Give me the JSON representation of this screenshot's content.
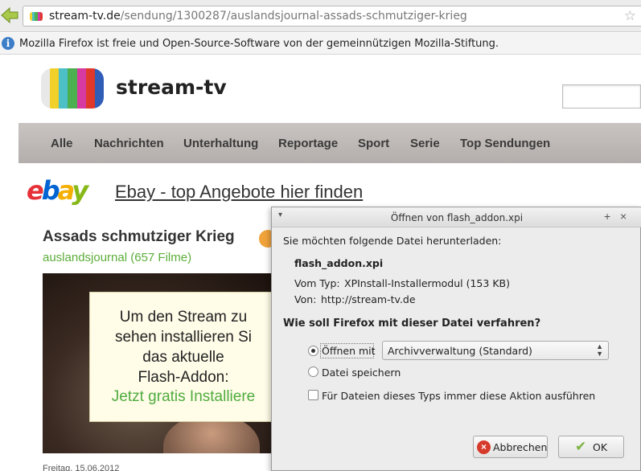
{
  "browser": {
    "url_host": "stream-tv.de",
    "url_path": "/sendung/1300287/auslandsjournal-assads-schmutziger-krieg",
    "info_message": "Mozilla Firefox ist freie und Open-Source-Software von der gemeinnützigen Mozilla-Stiftung."
  },
  "site": {
    "title": "stream-tv",
    "logo_colors": [
      "#e8e8e8",
      "#f2d02a",
      "#4cc0c6",
      "#4caf50",
      "#d63aa0",
      "#e0392b",
      "#2f5db8"
    ],
    "nav": [
      "Alle",
      "Nachrichten",
      "Unterhaltung",
      "Reportage",
      "Sport",
      "Serie",
      "Top Sendungen"
    ]
  },
  "ad": {
    "logo_letters": [
      "e",
      "b",
      "a",
      "y"
    ],
    "logo_colors": [
      "#e53238",
      "#0064d2",
      "#f5af02",
      "#86b817"
    ],
    "link_text": "Ebay - top Angebote hier finden"
  },
  "article": {
    "title": "Assads schmutziger Krieg",
    "channel": "auslandsjournal (657 Filme)",
    "overlay_lines": [
      "Um den Stream zu",
      "sehen installieren Si",
      "das aktuelle",
      "Flash-Addon:"
    ],
    "overlay_link": "Jetzt gratis Installiere",
    "date": "Freitag, 15.06.2012"
  },
  "dialog": {
    "menu_glyph": "▾",
    "title": "Öffnen von flash_addon.xpi",
    "pin_glyph": "+",
    "close_glyph": "×",
    "prompt": "Sie möchten folgende Datei herunterladen:",
    "filename": "flash_addon.xpi",
    "type_label": "Vom Typ:",
    "type_value": "XPInstall-Installermodul (153 KB)",
    "from_label": "Von:",
    "from_value": "http://stream-tv.de",
    "question": "Wie soll Firefox mit dieser Datei verfahren?",
    "open_with_label": "Öffnen mit",
    "open_with_app": "Archivverwaltung (Standard)",
    "save_label": "Datei speichern",
    "always_label": "Für Dateien dieses Typs immer diese Aktion ausführen",
    "cancel_label": "Abbrechen",
    "ok_label": "OK"
  }
}
